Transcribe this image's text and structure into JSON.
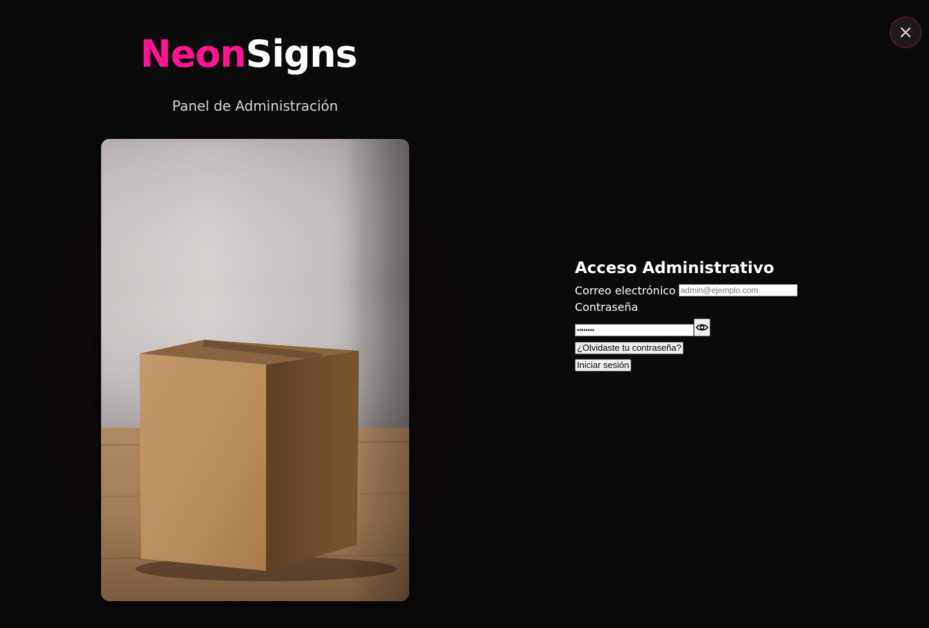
{
  "brand": {
    "part1": "Neon",
    "part2": "Signs",
    "part1_color": "#ff1493",
    "part2_color": "#ffffff"
  },
  "subtitle": "Panel de Administración",
  "close": {
    "icon": "close-icon"
  },
  "login": {
    "title": "Acceso Administrativo",
    "email_label": "Correo electrónico",
    "email_placeholder": "admin@ejemplo.com",
    "email_value": "",
    "password_label": "Contraseña",
    "password_value": "********",
    "toggle_icon": "eye-icon",
    "forgot_label": "¿Olvidaste tu contraseña?",
    "submit_label": "Iniciar sesión"
  },
  "image": {
    "subject": "cardboard-box-photo"
  },
  "colors": {
    "background": "#0b0a0b",
    "accent": "#ff1493"
  }
}
